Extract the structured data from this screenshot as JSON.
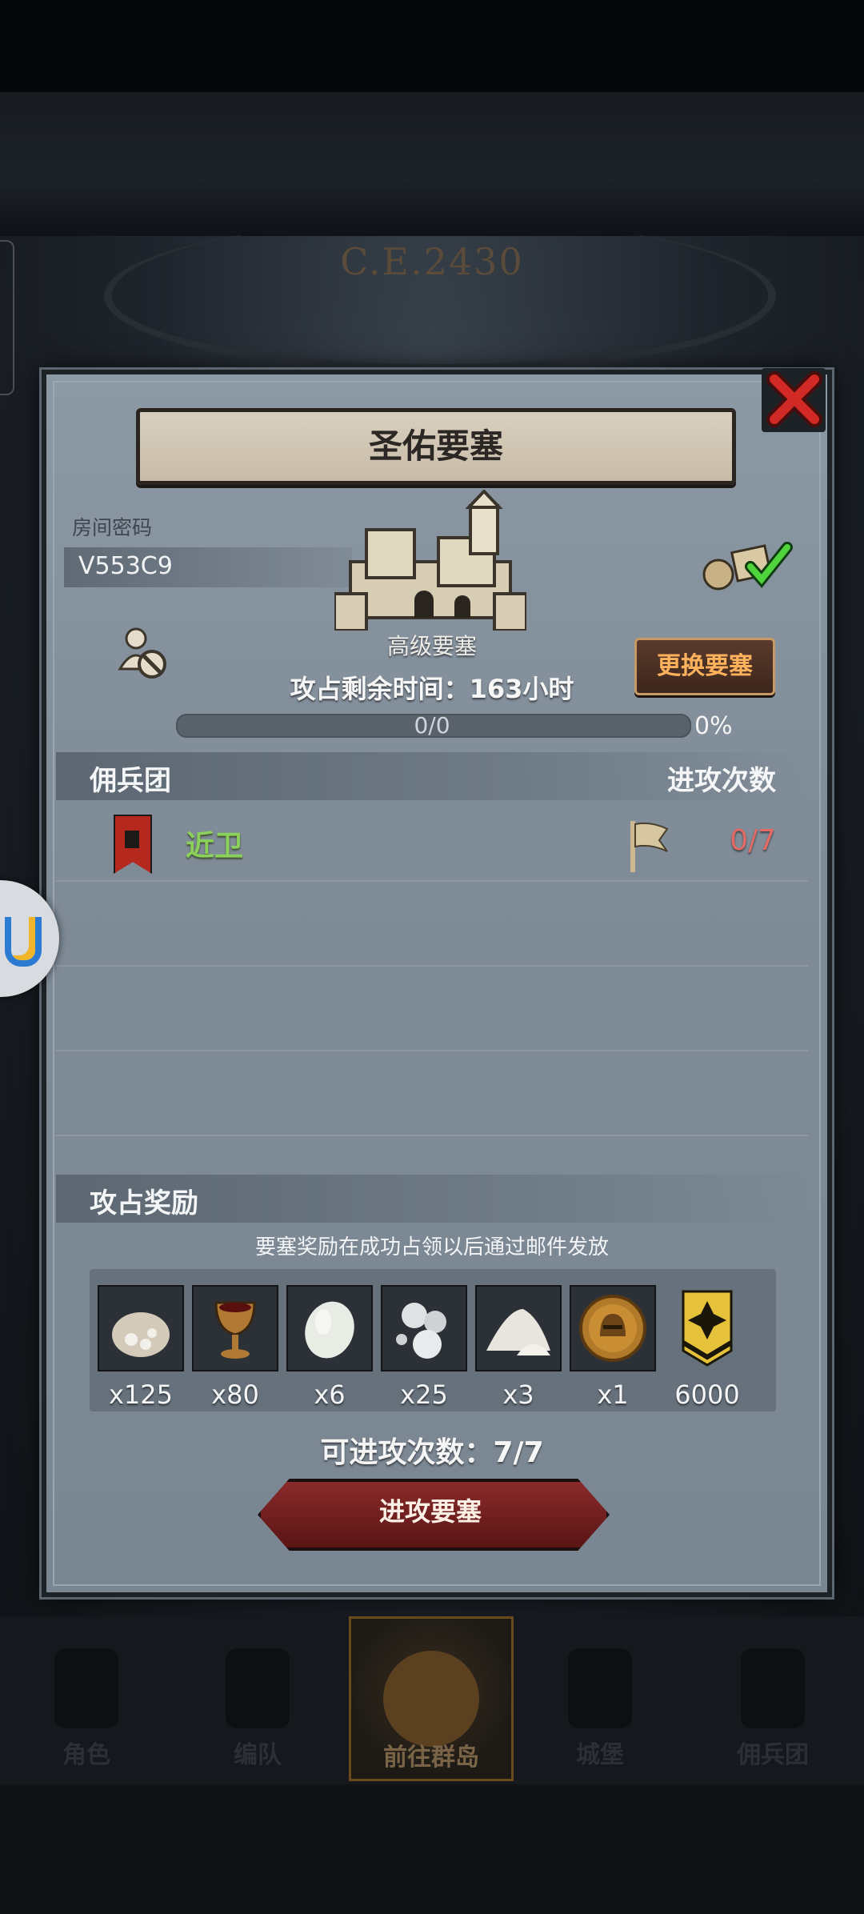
{
  "background": {
    "era_text": "C.E.2430"
  },
  "dialog": {
    "title": "圣佑要塞",
    "room_code_label": "房间密码",
    "room_code": "V553C9",
    "fortress_grade": "高级要塞",
    "change_button": "更换要塞",
    "timer_label": "攻占剩余时间：",
    "timer_value": "163",
    "timer_unit": "小时",
    "progress": {
      "text": "0/0",
      "percent_label": "0%",
      "fraction": 0
    },
    "guild_section": {
      "left": "佣兵团",
      "right": "进攻次数"
    },
    "guilds": [
      {
        "name": "近卫",
        "attacks": "0/7"
      }
    ],
    "reward_section": {
      "title": "攻占奖励",
      "note": "要塞奖励在成功占领以后通过邮件发放"
    },
    "rewards": [
      {
        "icon": "sack-icon",
        "qty": "x125"
      },
      {
        "icon": "goblet-icon",
        "qty": "x80"
      },
      {
        "icon": "stone-icon",
        "qty": "x6"
      },
      {
        "icon": "pearls-icon",
        "qty": "x25"
      },
      {
        "icon": "powder-icon",
        "qty": "x3"
      },
      {
        "icon": "helmet-coin-icon",
        "qty": "x1"
      },
      {
        "icon": "rank-badge-icon",
        "qty": "6000"
      }
    ],
    "attacks_left": "可进攻次数：7/7",
    "attack_button": "进攻要塞"
  },
  "bottom_nav": [
    {
      "label": "角色"
    },
    {
      "label": "编队"
    },
    {
      "label": "前往群岛",
      "active": true
    },
    {
      "label": "城堡"
    },
    {
      "label": "佣兵团"
    }
  ],
  "colors": {
    "accent_orange": "#ffb25b",
    "guild_green": "#8bd05a",
    "count_red": "#e26a64",
    "button_red": "#8a2a2a"
  }
}
